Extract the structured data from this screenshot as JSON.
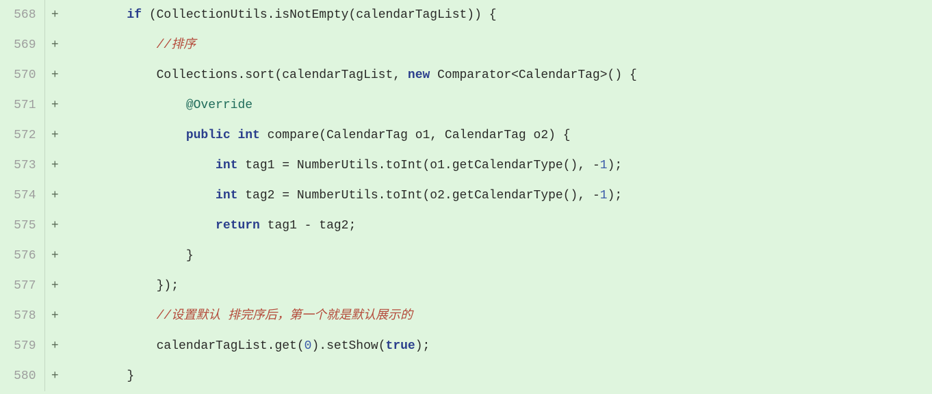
{
  "lines": [
    {
      "num": "568",
      "marker": "+",
      "indent": "        ",
      "tokens": [
        {
          "cls": "kw",
          "t": "if"
        },
        {
          "cls": "",
          "t": " (CollectionUtils.isNotEmpty(calendarTagList)) {"
        }
      ]
    },
    {
      "num": "569",
      "marker": "+",
      "indent": "            ",
      "tokens": [
        {
          "cls": "comment",
          "t": "//排序"
        }
      ]
    },
    {
      "num": "570",
      "marker": "+",
      "indent": "            ",
      "tokens": [
        {
          "cls": "",
          "t": "Collections.sort(calendarTagList, "
        },
        {
          "cls": "kw",
          "t": "new"
        },
        {
          "cls": "",
          "t": " Comparator<CalendarTag>() {"
        }
      ]
    },
    {
      "num": "571",
      "marker": "+",
      "indent": "                ",
      "tokens": [
        {
          "cls": "anno",
          "t": "@Override"
        }
      ]
    },
    {
      "num": "572",
      "marker": "+",
      "indent": "                ",
      "tokens": [
        {
          "cls": "kw",
          "t": "public"
        },
        {
          "cls": "",
          "t": " "
        },
        {
          "cls": "kw",
          "t": "int"
        },
        {
          "cls": "",
          "t": " compare(CalendarTag o1, CalendarTag o2) {"
        }
      ]
    },
    {
      "num": "573",
      "marker": "+",
      "indent": "                    ",
      "tokens": [
        {
          "cls": "kw",
          "t": "int"
        },
        {
          "cls": "",
          "t": " tag1 = NumberUtils.toInt(o1.getCalendarType(), -"
        },
        {
          "cls": "num",
          "t": "1"
        },
        {
          "cls": "",
          "t": ");"
        }
      ]
    },
    {
      "num": "574",
      "marker": "+",
      "indent": "                    ",
      "tokens": [
        {
          "cls": "kw",
          "t": "int"
        },
        {
          "cls": "",
          "t": " tag2 = NumberUtils.toInt(o2.getCalendarType(), -"
        },
        {
          "cls": "num",
          "t": "1"
        },
        {
          "cls": "",
          "t": ");"
        }
      ]
    },
    {
      "num": "575",
      "marker": "+",
      "indent": "                    ",
      "tokens": [
        {
          "cls": "kw",
          "t": "return"
        },
        {
          "cls": "",
          "t": " tag1 - tag2;"
        }
      ]
    },
    {
      "num": "576",
      "marker": "+",
      "indent": "                ",
      "tokens": [
        {
          "cls": "",
          "t": "}"
        }
      ]
    },
    {
      "num": "577",
      "marker": "+",
      "indent": "            ",
      "tokens": [
        {
          "cls": "",
          "t": "});"
        }
      ]
    },
    {
      "num": "578",
      "marker": "+",
      "indent": "            ",
      "tokens": [
        {
          "cls": "comment",
          "t": "//设置默认 排完序后，第一个就是默认展示的"
        }
      ]
    },
    {
      "num": "579",
      "marker": "+",
      "indent": "            ",
      "tokens": [
        {
          "cls": "",
          "t": "calendarTagList.get("
        },
        {
          "cls": "num",
          "t": "0"
        },
        {
          "cls": "",
          "t": ").setShow("
        },
        {
          "cls": "bool",
          "t": "true"
        },
        {
          "cls": "",
          "t": ");"
        }
      ]
    },
    {
      "num": "580",
      "marker": "+",
      "indent": "        ",
      "tokens": [
        {
          "cls": "",
          "t": "}"
        }
      ]
    }
  ]
}
